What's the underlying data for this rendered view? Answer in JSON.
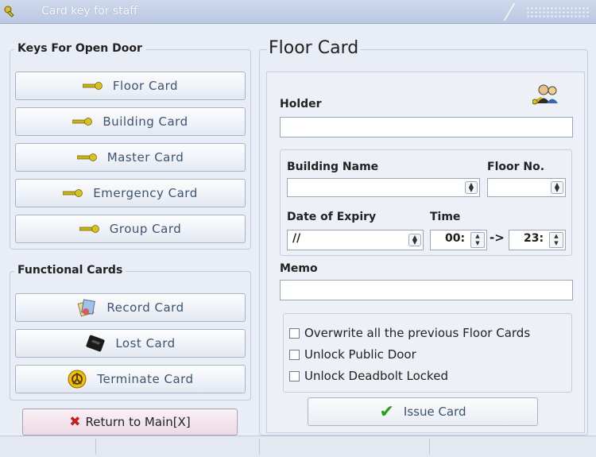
{
  "window": {
    "title": "Card key for staff"
  },
  "keys_group": {
    "title": "Keys For Open Door",
    "buttons": [
      {
        "label": "Floor Card",
        "icon": "key-icon"
      },
      {
        "label": "Building Card",
        "icon": "key-icon"
      },
      {
        "label": "Master Card",
        "icon": "key-icon"
      },
      {
        "label": "Emergency Card",
        "icon": "key-icon"
      },
      {
        "label": "Group Card",
        "icon": "key-icon"
      }
    ]
  },
  "functional_group": {
    "title": "Functional Cards",
    "buttons": [
      {
        "label": "Record Card",
        "icon": "record-card-icon"
      },
      {
        "label": "Lost Card",
        "icon": "lost-card-icon"
      },
      {
        "label": "Terminate Card",
        "icon": "terminate-card-icon"
      }
    ]
  },
  "return_button": {
    "label": "Return to Main[X]",
    "icon": "close-x-icon"
  },
  "panel": {
    "title": "Floor Card",
    "holder_label": "Holder",
    "holder_value": "",
    "building_name_label": "Building Name",
    "building_name_value": "",
    "floor_no_label": "Floor No.",
    "floor_no_value": "",
    "expiry_label": "Date of Expiry",
    "expiry_value": "//",
    "time_label": "Time",
    "time_from": "00:",
    "time_arrow": "->",
    "time_to": "23:",
    "memo_label": "Memo",
    "memo_value": "",
    "options": [
      {
        "label": "Overwrite all the previous Floor Cards",
        "checked": false
      },
      {
        "label": "Unlock Public Door",
        "checked": false
      },
      {
        "label": "Unlock Deadbolt Locked",
        "checked": false
      }
    ],
    "issue_button": "Issue Card"
  },
  "colors": {
    "accent_text": "#3c5373",
    "key_gold": "#c9b21a",
    "issue_check": "#27a019",
    "return_x": "#c81d1d"
  }
}
